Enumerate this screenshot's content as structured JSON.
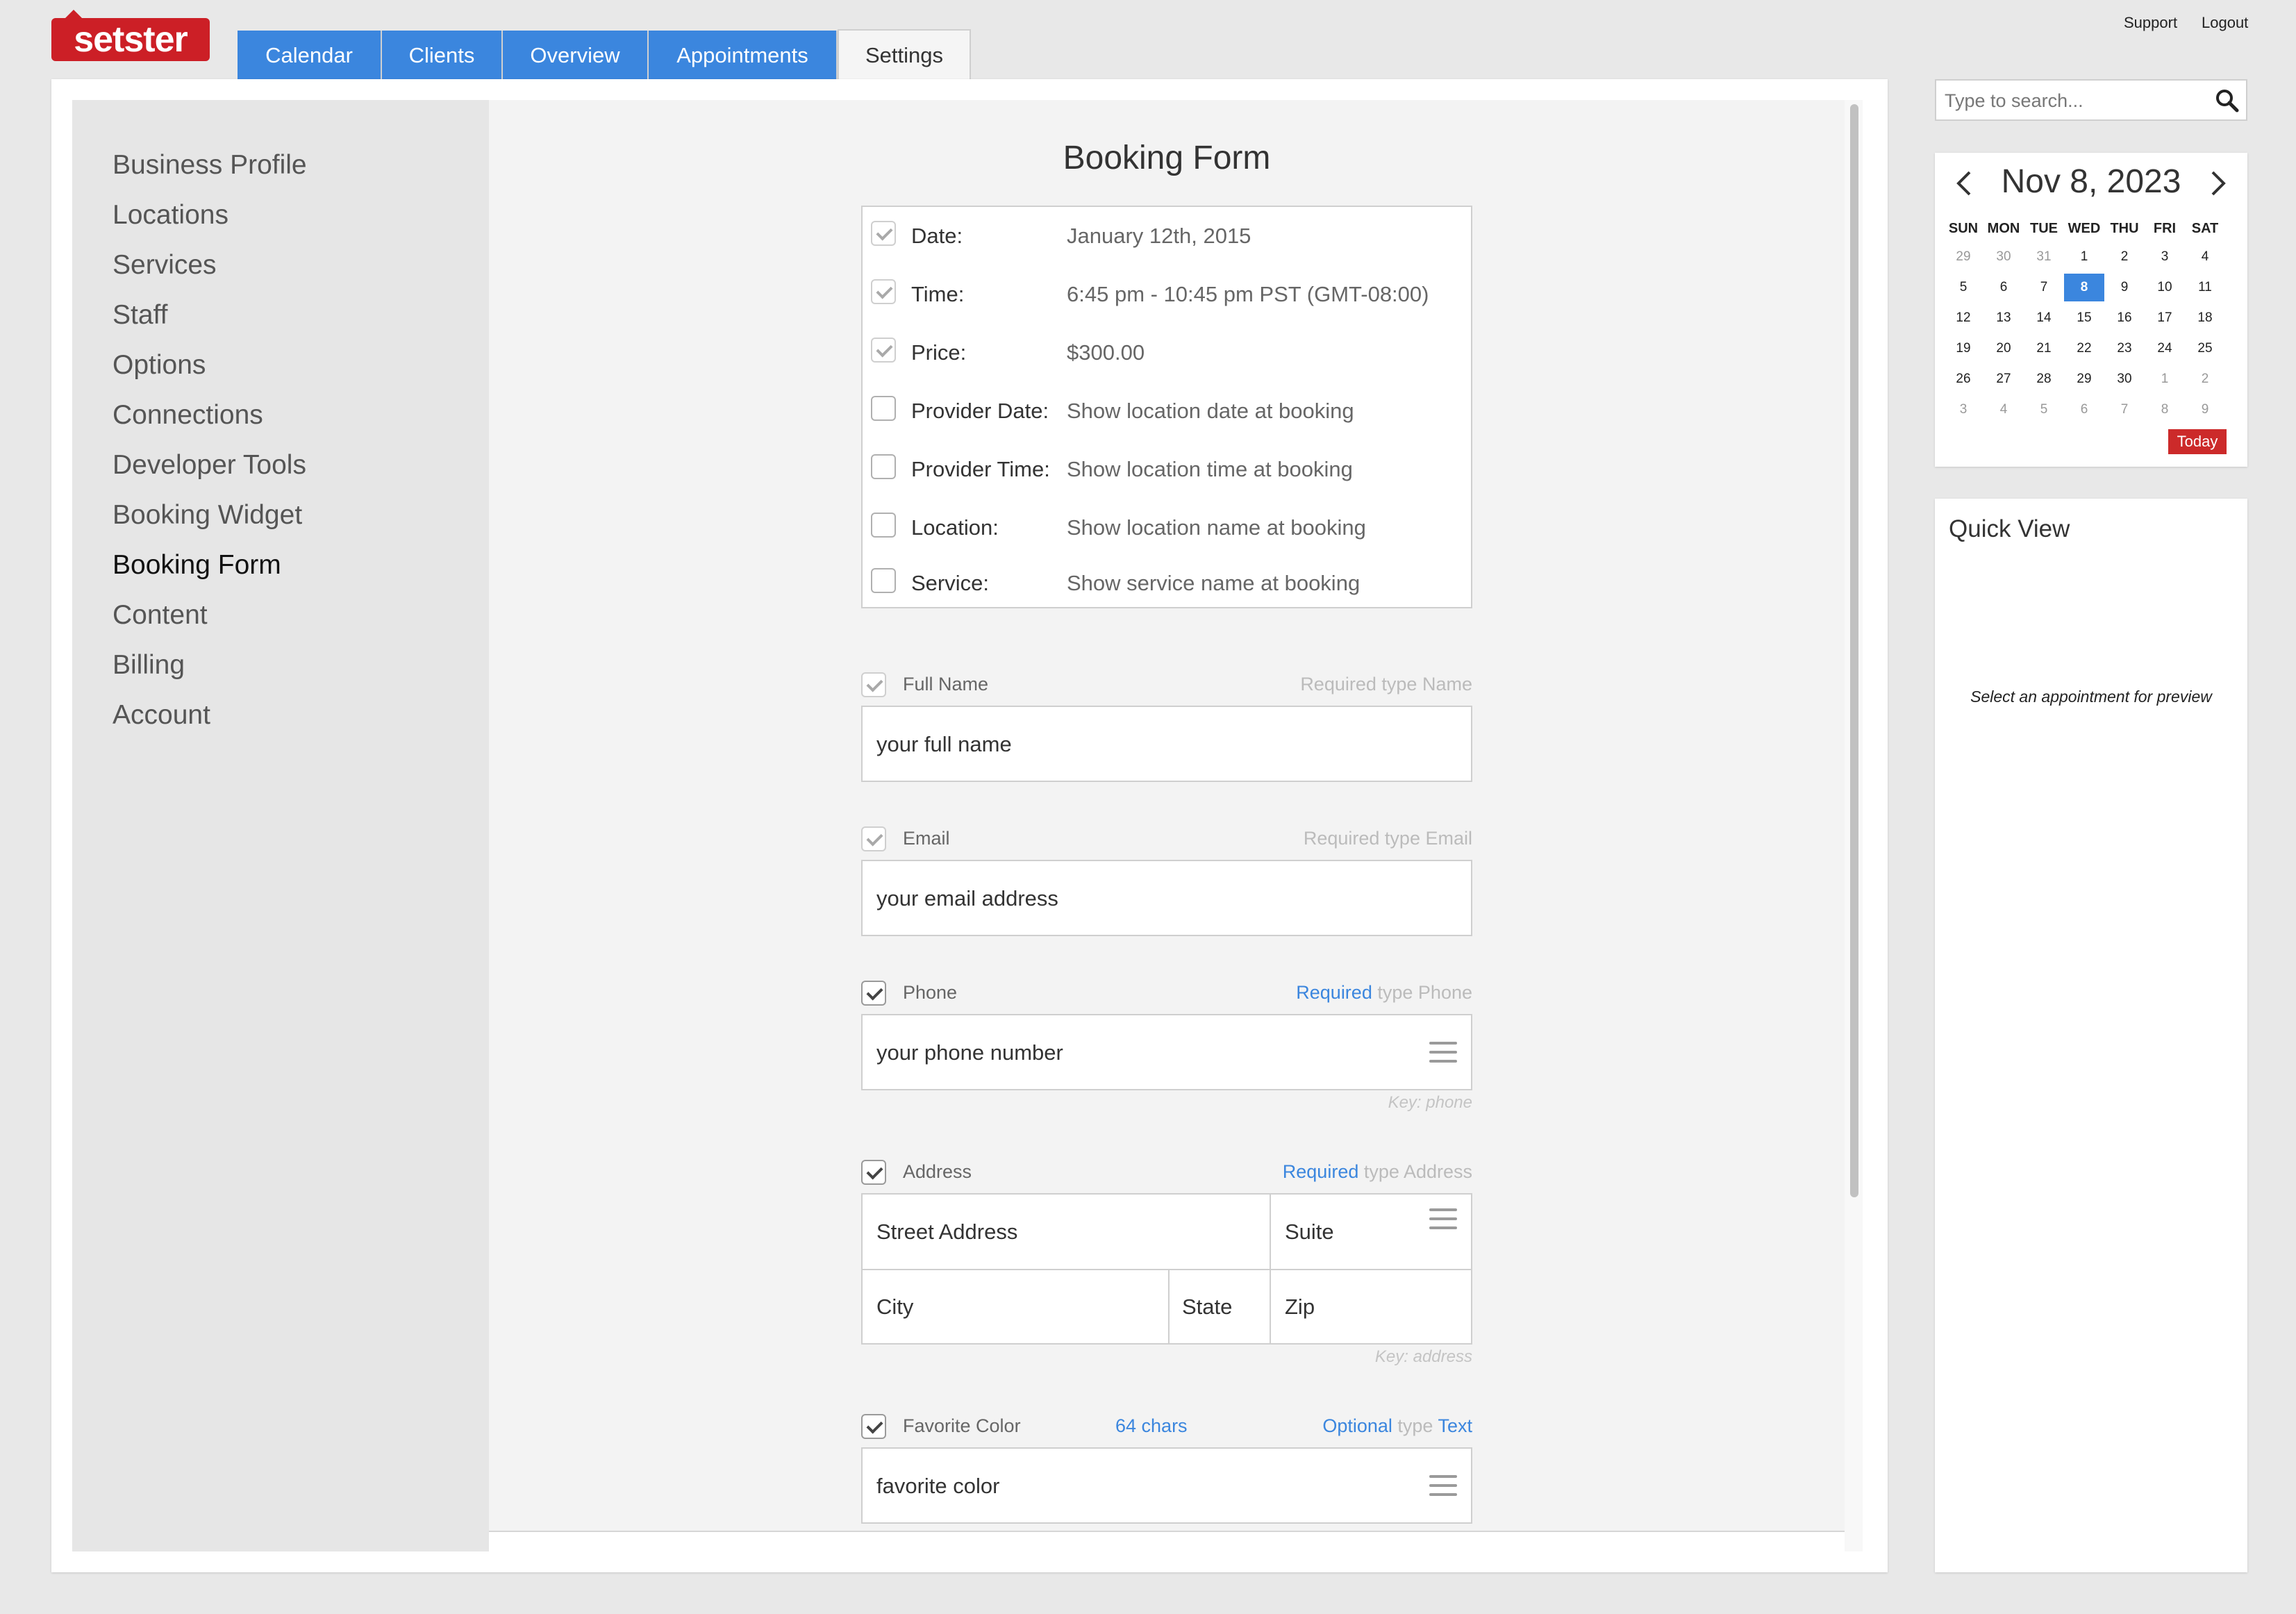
{
  "brand": {
    "logo_text": "setster",
    "color": "#cc1f26"
  },
  "tabs": [
    {
      "label": "Calendar"
    },
    {
      "label": "Clients"
    },
    {
      "label": "Overview"
    },
    {
      "label": "Appointments"
    },
    {
      "label": "Settings"
    }
  ],
  "active_tab": "Settings",
  "top_links": {
    "support": "Support",
    "logout": "Logout"
  },
  "sidebar": {
    "items": [
      {
        "label": "Business Profile"
      },
      {
        "label": "Locations"
      },
      {
        "label": "Services"
      },
      {
        "label": "Staff"
      },
      {
        "label": "Options"
      },
      {
        "label": "Connections"
      },
      {
        "label": "Developer Tools"
      },
      {
        "label": "Booking Widget"
      },
      {
        "label": "Booking Form"
      },
      {
        "label": "Content"
      },
      {
        "label": "Billing"
      },
      {
        "label": "Account"
      }
    ],
    "active": "Booking Form"
  },
  "booking_form": {
    "title": "Booking Form",
    "info_rows": [
      {
        "label": "Date:",
        "value": "January 12th, 2015",
        "checked": true
      },
      {
        "label": "Time:",
        "value": "6:45 pm - 10:45 pm PST (GMT-08:00)",
        "checked": true
      },
      {
        "label": "Price:",
        "value": "$300.00",
        "checked": true
      },
      {
        "label": "Provider Date:",
        "value": "Show location date at booking",
        "checked": false
      },
      {
        "label": "Provider Time:",
        "value": "Show location time at booking",
        "checked": false
      },
      {
        "label": "Location:",
        "value": "Show location name at booking",
        "checked": false
      },
      {
        "label": "Service:",
        "value": "Show service name at booking",
        "checked": false
      }
    ],
    "fields": {
      "full_name": {
        "label": "Full Name",
        "required": "Required",
        "type_word": "type",
        "type": "Name",
        "placeholder": "your full name"
      },
      "email": {
        "label": "Email",
        "required": "Required",
        "type_word": "type",
        "type": "Email",
        "placeholder": "your email address"
      },
      "phone": {
        "label": "Phone",
        "required": "Required",
        "type_word": "type",
        "type": "Phone",
        "placeholder": "your phone number",
        "key": "Key: phone"
      },
      "address": {
        "label": "Address",
        "required": "Required",
        "type_word": "type",
        "type": "Address",
        "street": "Street Address",
        "suite": "Suite",
        "city": "City",
        "state": "State",
        "zip": "Zip",
        "key": "Key: address"
      },
      "favorite_color": {
        "label": "Favorite Color",
        "chars": "64 chars",
        "required": "Optional",
        "type_word": "type",
        "type": "Text",
        "placeholder": "favorite color"
      }
    }
  },
  "search": {
    "placeholder": "Type to search..."
  },
  "calendar": {
    "title": "Nov 8, 2023",
    "dow": [
      "SUN",
      "MON",
      "TUE",
      "WED",
      "THU",
      "FRI",
      "SAT"
    ],
    "weeks": [
      [
        "29",
        "30",
        "31",
        "1",
        "2",
        "3",
        "4"
      ],
      [
        "5",
        "6",
        "7",
        "8",
        "9",
        "10",
        "11"
      ],
      [
        "12",
        "13",
        "14",
        "15",
        "16",
        "17",
        "18"
      ],
      [
        "19",
        "20",
        "21",
        "22",
        "23",
        "24",
        "25"
      ],
      [
        "26",
        "27",
        "28",
        "29",
        "30",
        "1",
        "2"
      ],
      [
        "3",
        "4",
        "5",
        "6",
        "7",
        "8",
        "9"
      ]
    ],
    "selected_day": "8",
    "today_label": "Today"
  },
  "quick_view": {
    "title": "Quick View",
    "empty_text": "Select an appointment for preview"
  },
  "colors": {
    "accent": "#3b86de",
    "danger": "#cc2a2a"
  }
}
